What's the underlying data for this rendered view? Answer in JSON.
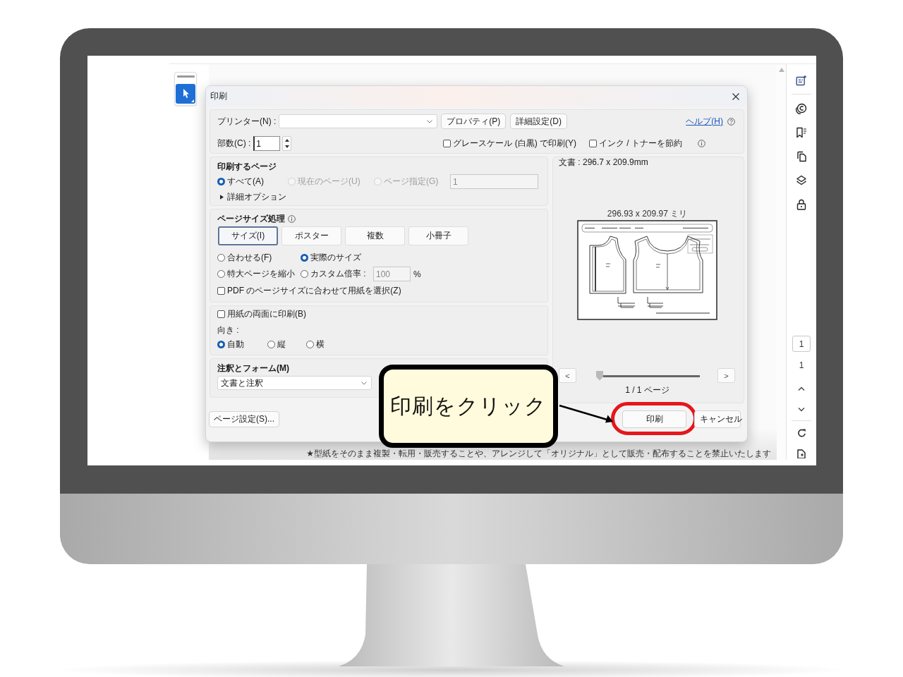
{
  "app": {
    "select_tool": {
      "selected": true
    },
    "sidebar": {
      "page_field": "1",
      "page_count": "1"
    },
    "footer_note": "★型紙をそのまま複製・転用・販売することや、アレンジして「オリジナル」として販売・配布することを禁止いたします"
  },
  "dialog": {
    "title": "印刷",
    "printer": {
      "label": "プリンター(N) :"
    },
    "top_buttons": [
      "プロパティ(P)",
      "詳細設定(D)"
    ],
    "help_link": "ヘルプ(H)",
    "copies": {
      "label": "部数(C) :",
      "value": "1"
    },
    "print_options": [
      {
        "label": "グレースケール (白黒) で印刷(Y)",
        "checked": false
      },
      {
        "label": "インク / トナーを節約",
        "checked": false
      }
    ],
    "pages": {
      "title": "印刷するページ",
      "options": [
        {
          "label": "すべて(A)",
          "selected": true,
          "disabled": false
        },
        {
          "label": "現在のページ(U)",
          "selected": false,
          "disabled": true
        },
        {
          "label": "ページ指定(G)",
          "selected": false,
          "disabled": true
        }
      ],
      "range": {
        "value": "1",
        "disabled": true
      },
      "more_options": {
        "label": "詳細オプション",
        "expanded": false
      }
    },
    "page_sizing": {
      "title": "ページサイズ処理",
      "tabs": [
        {
          "label": "サイズ(I)",
          "selected": true
        },
        {
          "label": "ポスター",
          "selected": false
        },
        {
          "label": "複数",
          "selected": false
        },
        {
          "label": "小冊子",
          "selected": false
        }
      ],
      "options": [
        {
          "label": "合わせる(F)",
          "selected": false
        },
        {
          "label": "実際のサイズ",
          "selected": true
        },
        {
          "label": "特大ページを縮小",
          "selected": false
        },
        {
          "label": "カスタム倍率 :",
          "selected": false
        }
      ],
      "custom_scale": {
        "value": "100",
        "disabled": true,
        "unit": "%"
      },
      "choose_paper": {
        "label": "PDF のページサイズに合わせて用紙を選択(Z)",
        "checked": false
      }
    },
    "duplex": {
      "label": "用紙の両面に印刷(B)",
      "checked": false
    },
    "orientation": {
      "label": "向き :",
      "options": [
        {
          "label": "自動",
          "selected": true
        },
        {
          "label": "縦",
          "selected": false
        },
        {
          "label": "横",
          "selected": false
        }
      ]
    },
    "annotations": {
      "title": "注釈とフォーム(M)",
      "value": "文書と注釈"
    },
    "page_setup_button": "ページ設定(S)...",
    "preview": {
      "document_size": "文書 : 296.7 x 209.9mm",
      "paper_size": "296.93 x 209.97 ミリ",
      "prev_button": "<",
      "next_button": ">",
      "level": 0,
      "page_indicator": "1 / 1 ページ"
    },
    "actions": [
      {
        "label": "印刷",
        "highlighted": true
      },
      {
        "label": "キャンセル",
        "highlighted": false
      }
    ]
  },
  "callout": {
    "text": "印刷をクリック"
  }
}
